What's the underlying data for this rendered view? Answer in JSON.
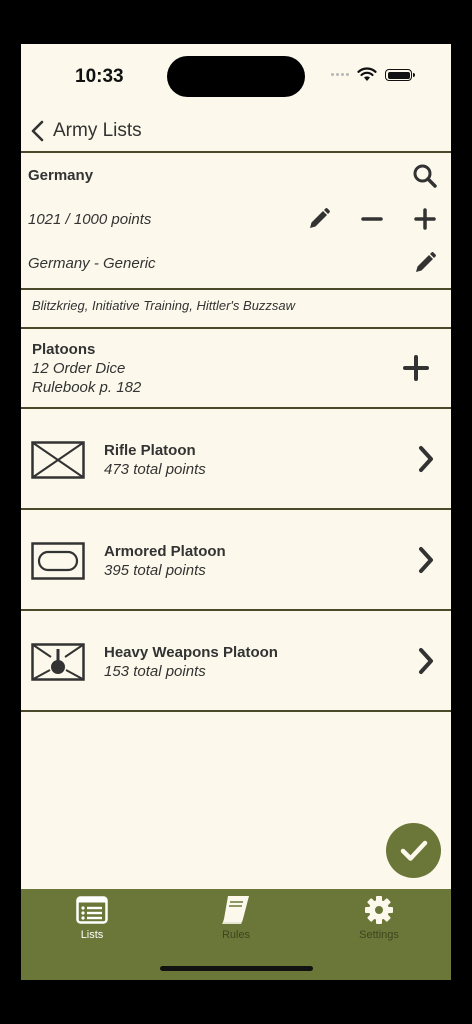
{
  "status": {
    "time": "10:33"
  },
  "nav": {
    "back_label": "Army Lists"
  },
  "army": {
    "name": "Germany",
    "points": "1021 / 1000 points",
    "selector": "Germany - Generic",
    "special_rules": "Blitzkrieg, Initiative Training, Hittler's Buzzsaw"
  },
  "platoons": {
    "title": "Platoons",
    "order_dice": "12 Order Dice",
    "rulebook": "Rulebook p. 182",
    "items": [
      {
        "name": "Rifle Platoon",
        "points": "473 total points",
        "icon": "infantry-symbol-icon"
      },
      {
        "name": "Armored Platoon",
        "points": "395 total points",
        "icon": "armor-symbol-icon"
      },
      {
        "name": "Heavy Weapons Platoon",
        "points": "153 total points",
        "icon": "heavy-weapons-symbol-icon"
      }
    ]
  },
  "tabs": [
    {
      "label": "Lists",
      "icon": "list-icon",
      "active": true
    },
    {
      "label": "Rules",
      "icon": "book-icon",
      "active": false
    },
    {
      "label": "Settings",
      "icon": "gear-icon",
      "active": false
    }
  ],
  "colors": {
    "background": "#fcf9ec",
    "accent": "#6b7738",
    "divider": "#4a4a2a",
    "text": "#333333",
    "tab_active": "#ffffff",
    "tab_inactive": "#3e4420"
  }
}
